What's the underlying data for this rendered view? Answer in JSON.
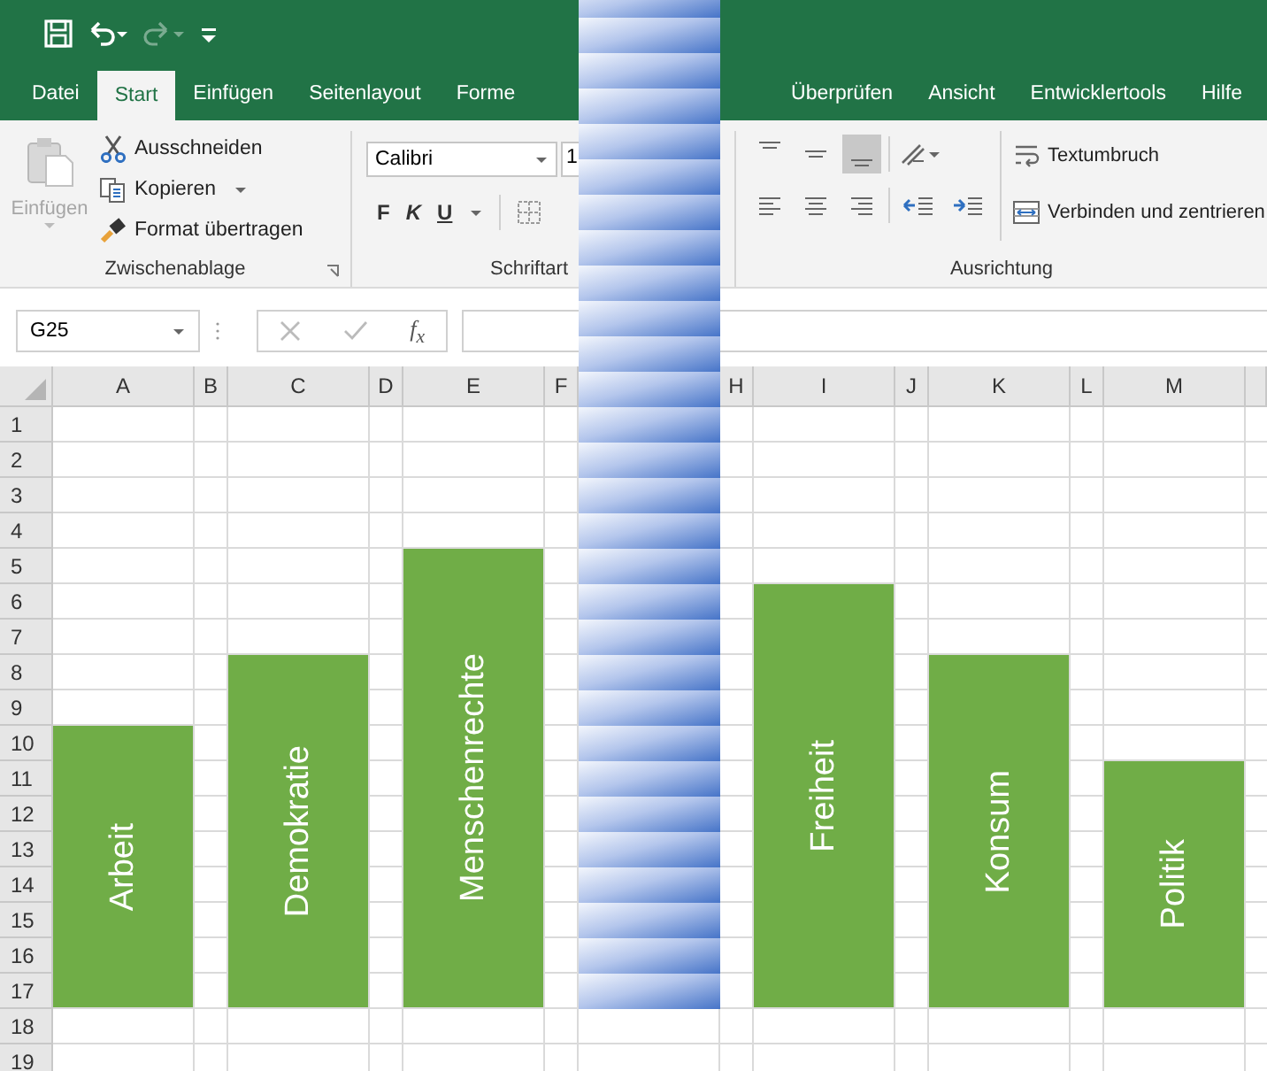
{
  "quick_access": {
    "undo": {
      "disabled": false
    },
    "redo": {
      "disabled": true
    }
  },
  "tabs": [
    {
      "label": "Datei",
      "selected": false
    },
    {
      "label": "Start",
      "selected": true
    },
    {
      "label": "Einfügen",
      "selected": false
    },
    {
      "label": "Seitenlayout",
      "selected": false
    },
    {
      "label": "Forme",
      "selected": false
    },
    {
      "label": "Überprüfen",
      "selected": false
    },
    {
      "label": "Ansicht",
      "selected": false
    },
    {
      "label": "Entwicklertools",
      "selected": false
    },
    {
      "label": "Hilfe",
      "selected": false
    }
  ],
  "ribbon": {
    "groups": [
      {
        "kind": "clipboard",
        "label": "Zwischenablage",
        "paste": {
          "label": "Einfügen",
          "disabled": true
        },
        "commands": [
          {
            "kind": "cut",
            "label": "Ausschneiden",
            "dropdown": false
          },
          {
            "kind": "copy",
            "label": "Kopieren",
            "dropdown": true
          },
          {
            "kind": "painter",
            "label": "Format übertragen",
            "dropdown": false
          }
        ]
      },
      {
        "kind": "font",
        "label": "Schriftart",
        "font_name": "Calibri",
        "font_size": "1",
        "format_buttons": [
          {
            "label": "F",
            "kind": "bold"
          },
          {
            "label": "K",
            "kind": "italic"
          },
          {
            "label": "U",
            "kind": "underline"
          }
        ]
      },
      {
        "kind": "alignment",
        "label": "Ausrichtung",
        "vertical_align": [
          {
            "selected": false
          },
          {
            "selected": false
          },
          {
            "selected": true
          }
        ],
        "wrap_text": "Textumbruch",
        "merge": "Verbinden und zentrieren"
      }
    ]
  },
  "formula_bar": {
    "name_box": "G25",
    "function_label": "f$_{x}$"
  },
  "sheet": {
    "columns": [
      {
        "label": "A",
        "shape": {
          "text": "Arbeit"
        }
      },
      {
        "label": "B"
      },
      {
        "label": "C",
        "shape": {
          "text": "Demokratie"
        }
      },
      {
        "label": "D"
      },
      {
        "label": "E",
        "shape": {
          "text": "Menschenrechte"
        }
      },
      {
        "label": "F"
      },
      {
        "overlay": {
          "kind": "striped-bar"
        }
      },
      {
        "label": "H"
      },
      {
        "label": "I",
        "shape": {
          "text": "Freiheit"
        }
      },
      {
        "label": "J"
      },
      {
        "label": "K",
        "shape": {
          "text": "Konsum"
        }
      },
      {
        "label": "L"
      },
      {
        "label": "M",
        "shape": {
          "text": "Politik"
        }
      }
    ],
    "rows": [
      "1",
      "2",
      "3",
      "4",
      "5",
      "6",
      "7",
      "8",
      "9",
      "10",
      "11",
      "12",
      "13",
      "14",
      "15",
      "16",
      "17",
      "18",
      "19"
    ]
  }
}
